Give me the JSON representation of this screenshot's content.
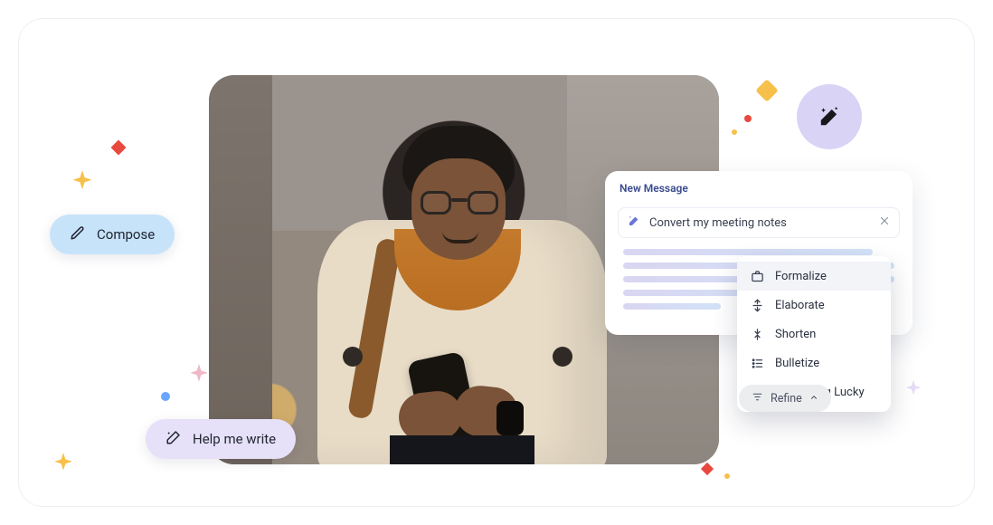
{
  "chips": {
    "compose_label": "Compose",
    "help_label": "Help me write"
  },
  "wand_button_label": "AI actions",
  "card": {
    "title": "New Message",
    "prompt_text": "Convert my meeting notes",
    "close_label": "Close"
  },
  "menu": {
    "items": [
      {
        "icon": "briefcase-icon",
        "label": "Formalize"
      },
      {
        "icon": "expand-vertical-icon",
        "label": "Elaborate"
      },
      {
        "icon": "collapse-vertical-icon",
        "label": "Shorten"
      },
      {
        "icon": "bullet-list-icon",
        "label": "Bulletize"
      },
      {
        "icon": "lucky-icon",
        "label": "I'm Feeling Lucky"
      }
    ]
  },
  "refine": {
    "label": "Refine"
  },
  "decor": {
    "colors": {
      "amber": "#f7c04a",
      "red": "#e8493e",
      "blue": "#6aa6ff",
      "lilac": "#e5ddf5",
      "pink": "#f1b6c7"
    }
  }
}
